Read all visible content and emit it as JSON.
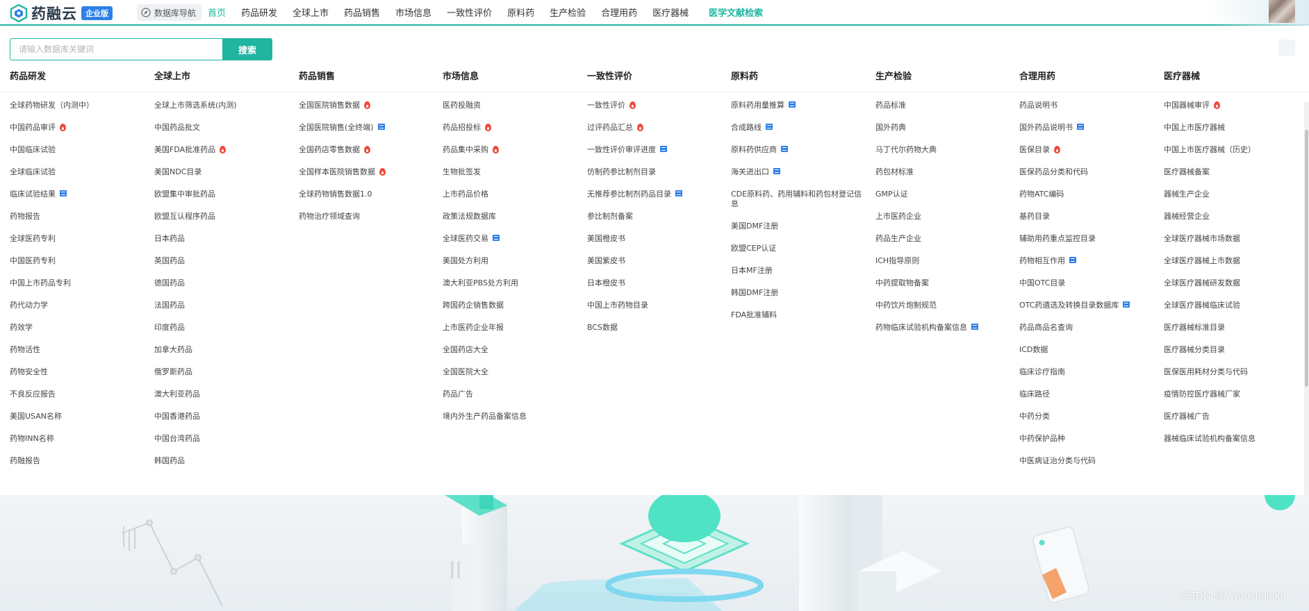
{
  "brand": {
    "name": "药融云",
    "badge": "企业版"
  },
  "db_nav_label": "数据库导航",
  "nav": [
    {
      "label": "首页",
      "active": true
    },
    {
      "label": "药品研发"
    },
    {
      "label": "全球上市"
    },
    {
      "label": "药品销售"
    },
    {
      "label": "市场信息"
    },
    {
      "label": "一致性评价"
    },
    {
      "label": "原料药"
    },
    {
      "label": "生产检验"
    },
    {
      "label": "合理用药"
    },
    {
      "label": "医疗器械"
    },
    {
      "label": "医学文献检索",
      "highlight": true
    }
  ],
  "search": {
    "placeholder": "请输入数据库关键词",
    "value": "",
    "button": "搜索"
  },
  "colors": {
    "accent": "#1fb5a0",
    "badge": "#2f7fe8",
    "hot": "#f04b3a",
    "new": "#2f7fe8"
  },
  "categories": [
    {
      "title": "药品研发",
      "items": [
        {
          "label": "全球药物研发（内测中）"
        },
        {
          "label": "中国药品审评",
          "tag": "hot"
        },
        {
          "label": "中国临床试验"
        },
        {
          "label": "全球临床试验"
        },
        {
          "label": "临床试验结果",
          "tag": "new"
        },
        {
          "label": "药物报告"
        },
        {
          "label": "全球医药专利"
        },
        {
          "label": "中国医药专利"
        },
        {
          "label": "中国上市药品专利"
        },
        {
          "label": "药代动力学"
        },
        {
          "label": "药效学"
        },
        {
          "label": "药物活性"
        },
        {
          "label": "药物安全性"
        },
        {
          "label": "不良反应报告"
        },
        {
          "label": "美国USAN名称"
        },
        {
          "label": "药物INN名称"
        },
        {
          "label": "药融报告"
        }
      ]
    },
    {
      "title": "全球上市",
      "items": [
        {
          "label": "全球上市筛选系统(内测)"
        },
        {
          "label": "中国药品批文"
        },
        {
          "label": "美国FDA批准药品",
          "tag": "hot"
        },
        {
          "label": "美国NDC目录"
        },
        {
          "label": "欧盟集中审批药品"
        },
        {
          "label": "欧盟互认程序药品"
        },
        {
          "label": "日本药品"
        },
        {
          "label": "英国药品"
        },
        {
          "label": "德国药品"
        },
        {
          "label": "法国药品"
        },
        {
          "label": "印度药品"
        },
        {
          "label": "加拿大药品"
        },
        {
          "label": "俄罗斯药品"
        },
        {
          "label": "澳大利亚药品"
        },
        {
          "label": "中国香港药品"
        },
        {
          "label": "中国台湾药品"
        },
        {
          "label": "韩国药品"
        }
      ]
    },
    {
      "title": "药品销售",
      "items": [
        {
          "label": "全国医院销售数据",
          "tag": "hot"
        },
        {
          "label": "全国医院销售(全终端)",
          "tag": "new"
        },
        {
          "label": "全国药店零售数据",
          "tag": "hot"
        },
        {
          "label": "全国样本医院销售数据",
          "tag": "hot"
        },
        {
          "label": "全球药物销售数据1.0"
        },
        {
          "label": "药物治疗领域查询"
        }
      ]
    },
    {
      "title": "市场信息",
      "items": [
        {
          "label": "医药投融资"
        },
        {
          "label": "药品招投标",
          "tag": "hot"
        },
        {
          "label": "药品集中采购",
          "tag": "hot"
        },
        {
          "label": "生物批签发"
        },
        {
          "label": "上市药品价格"
        },
        {
          "label": "政策法规数据库"
        },
        {
          "label": "全球医药交易",
          "tag": "new"
        },
        {
          "label": "美国处方利用"
        },
        {
          "label": "澳大利亚PBS处方利用"
        },
        {
          "label": "跨国药企销售数据"
        },
        {
          "label": "上市医药企业年报"
        },
        {
          "label": "全国药店大全"
        },
        {
          "label": "全国医院大全"
        },
        {
          "label": "药品广告"
        },
        {
          "label": "境内外生产药品备案信息"
        }
      ]
    },
    {
      "title": "一致性评价",
      "items": [
        {
          "label": "一致性评价",
          "tag": "hot"
        },
        {
          "label": "过评药品汇总",
          "tag": "hot"
        },
        {
          "label": "一致性评价审评进度",
          "tag": "new"
        },
        {
          "label": "仿制药参比制剂目录"
        },
        {
          "label": "无推荐参比制剂药品目录",
          "tag": "new"
        },
        {
          "label": "参比制剂备案"
        },
        {
          "label": "美国橙皮书"
        },
        {
          "label": "美国紫皮书"
        },
        {
          "label": "日本橙皮书"
        },
        {
          "label": "中国上市药物目录"
        },
        {
          "label": "BCS数据"
        }
      ]
    },
    {
      "title": "原料药",
      "items": [
        {
          "label": "原料药用量推算",
          "tag": "new"
        },
        {
          "label": "合成路线",
          "tag": "new"
        },
        {
          "label": "原料药供应商",
          "tag": "new"
        },
        {
          "label": "海关进出口",
          "tag": "new"
        },
        {
          "label": "CDE原料药、药用辅料和药包材登记信息",
          "wrap": true
        },
        {
          "label": "美国DMF注册"
        },
        {
          "label": "欧盟CEP认证"
        },
        {
          "label": "日本MF注册"
        },
        {
          "label": "韩国DMF注册"
        },
        {
          "label": "FDA批准辅料"
        }
      ]
    },
    {
      "title": "生产检验",
      "items": [
        {
          "label": "药品标准"
        },
        {
          "label": "国外药典"
        },
        {
          "label": "马丁代尔药物大典"
        },
        {
          "label": "药包材标准"
        },
        {
          "label": "GMP认证"
        },
        {
          "label": "上市医药企业"
        },
        {
          "label": "药品生产企业"
        },
        {
          "label": "ICH指导原则"
        },
        {
          "label": "中药提取物备案"
        },
        {
          "label": "中药饮片炮制规范"
        },
        {
          "label": "药物临床试验机构备案信息",
          "tag": "new"
        }
      ]
    },
    {
      "title": "合理用药",
      "items": [
        {
          "label": "药品说明书"
        },
        {
          "label": "国外药品说明书",
          "tag": "new"
        },
        {
          "label": "医保目录",
          "tag": "hot"
        },
        {
          "label": "医保药品分类和代码"
        },
        {
          "label": "药物ATC编码"
        },
        {
          "label": "基药目录"
        },
        {
          "label": "辅助用药重点监控目录"
        },
        {
          "label": "药物相互作用",
          "tag": "new"
        },
        {
          "label": "中国OTC目录"
        },
        {
          "label": "OTC药遴选及转换目录数据库",
          "tag": "new"
        },
        {
          "label": "药品商品名查询"
        },
        {
          "label": "ICD数据"
        },
        {
          "label": "临床诊疗指南"
        },
        {
          "label": "临床路径"
        },
        {
          "label": "中药分类"
        },
        {
          "label": "中药保护品种"
        },
        {
          "label": "中医病证治分类与代码"
        }
      ]
    },
    {
      "title": "医疗器械",
      "items": [
        {
          "label": "中国器械审评",
          "tag": "hot"
        },
        {
          "label": "中国上市医疗器械"
        },
        {
          "label": "中国上市医疗器械（历史）"
        },
        {
          "label": "医疗器械备案"
        },
        {
          "label": "器械生产企业"
        },
        {
          "label": "器械经营企业"
        },
        {
          "label": "全球医疗器械市场数据"
        },
        {
          "label": "全球医疗器械上市数据"
        },
        {
          "label": "全球医疗器械研发数据"
        },
        {
          "label": "全球医疗器械临床试验"
        },
        {
          "label": "医疗器械标准目录"
        },
        {
          "label": "医疗器械分类目录"
        },
        {
          "label": "医保医用耗材分类与代码"
        },
        {
          "label": "疫情防控医疗器械厂家"
        },
        {
          "label": "医疗器械广告"
        },
        {
          "label": "器械临床试验机构备案信息"
        }
      ]
    }
  ],
  "watermark": "CSDN @Yiyaoshujuku"
}
